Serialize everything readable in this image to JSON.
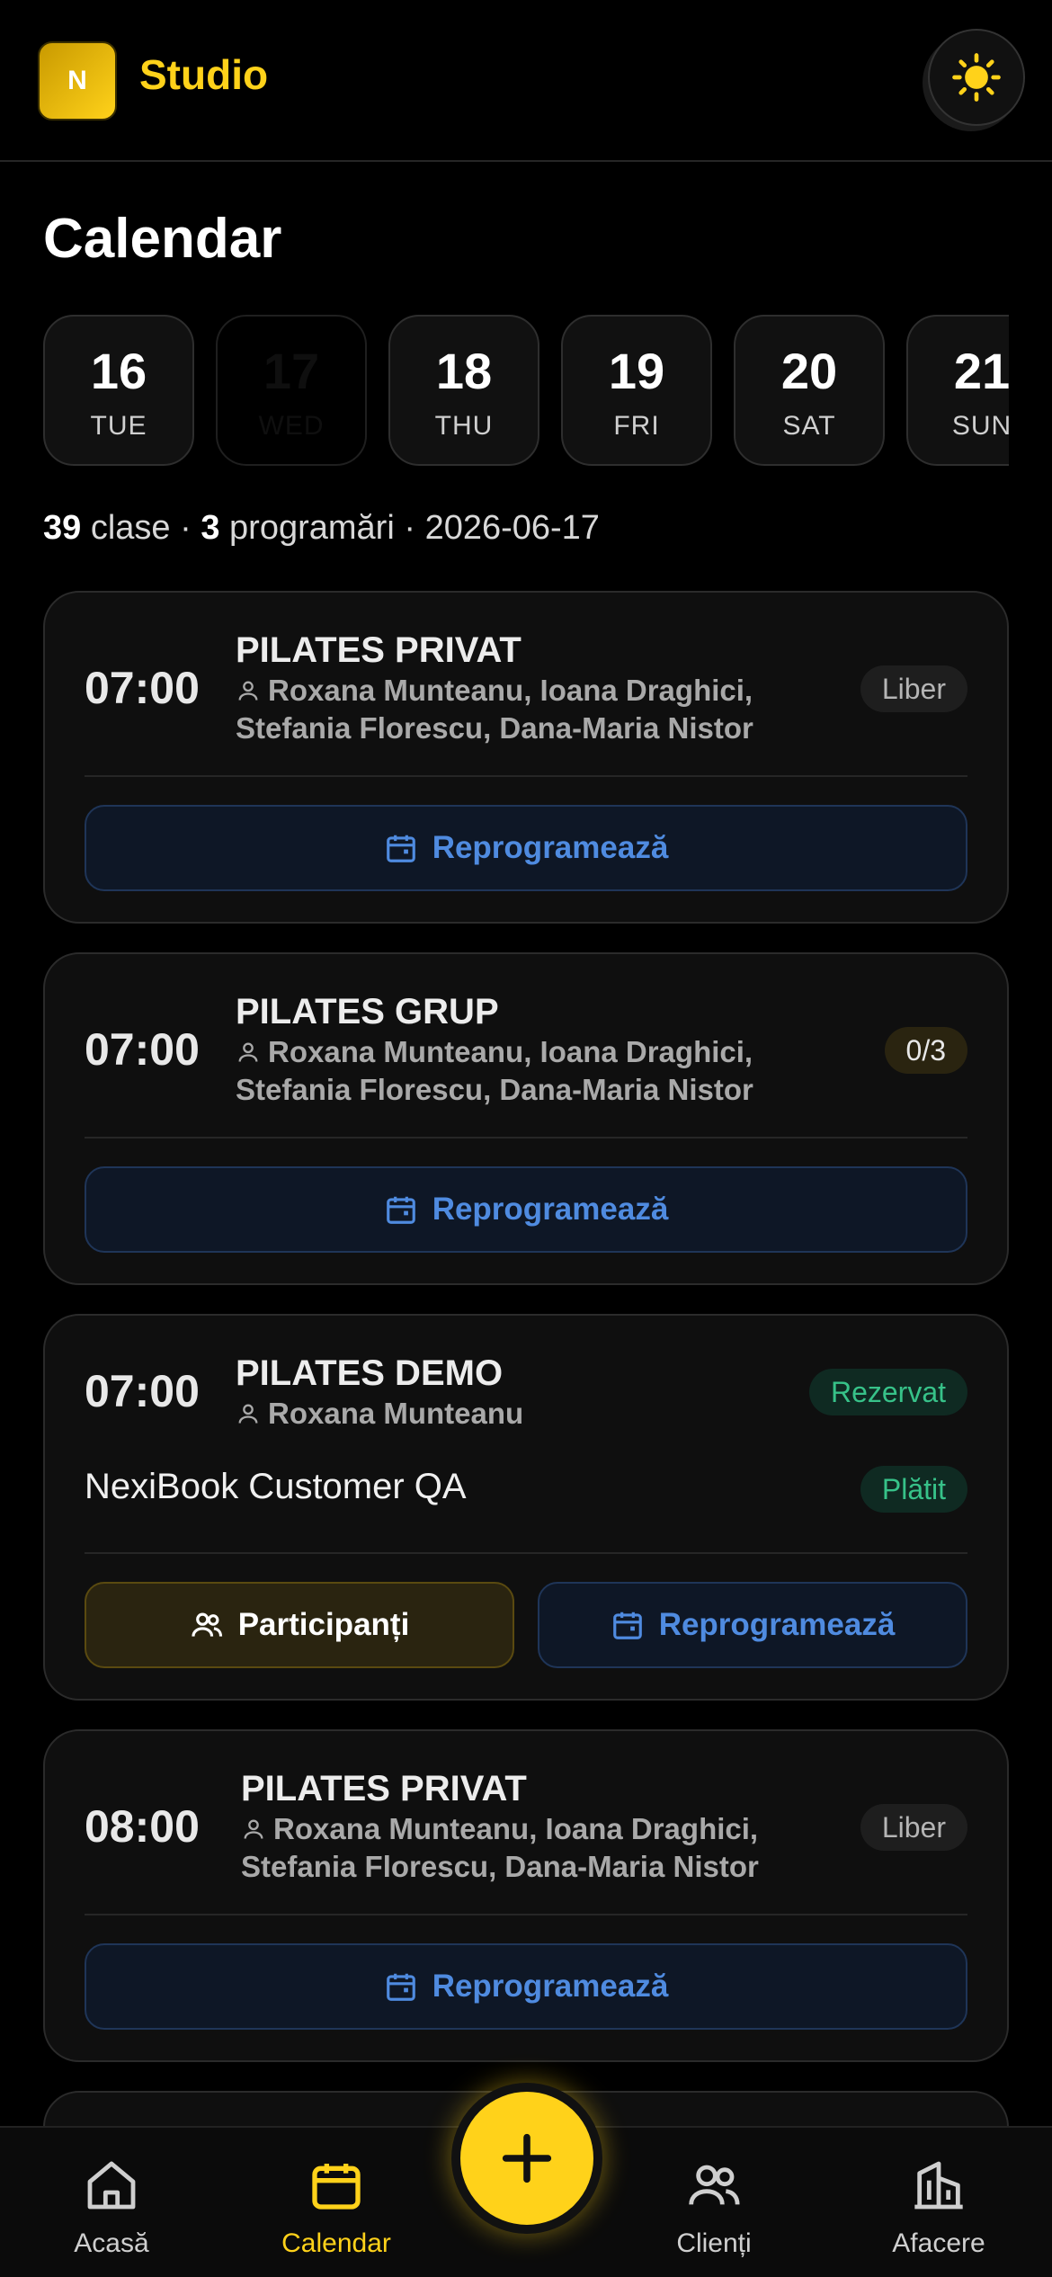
{
  "header": {
    "logo_letter": "N",
    "brand": "Studio",
    "theme_icon": "sun-icon"
  },
  "page_title": "Calendar",
  "days": [
    {
      "num": "16",
      "dow": "TUE"
    },
    {
      "num": "17",
      "dow": "WED",
      "selected": true
    },
    {
      "num": "18",
      "dow": "THU"
    },
    {
      "num": "19",
      "dow": "FRI"
    },
    {
      "num": "20",
      "dow": "SAT"
    },
    {
      "num": "21",
      "dow": "SUN"
    }
  ],
  "summary": {
    "classes_count": "39",
    "classes_label": "clase",
    "bookings_count": "3",
    "bookings_label": "programări",
    "date": "2026-06-17",
    "sep": "·"
  },
  "cards": [
    {
      "time": "07:00",
      "name": "PILATES PRIVAT",
      "people": "Roxana Munteanu, Ioana Draghici, Stefania Florescu, Dana-Maria Nistor",
      "badge": "Liber",
      "reschedule": "Reprogramează"
    },
    {
      "time": "07:00",
      "name": "PILATES GRUP",
      "people": "Roxana Munteanu, Ioana Draghici, Stefania Florescu, Dana-Maria Nistor",
      "badge": "0/3",
      "reschedule": "Reprogramează"
    },
    {
      "time": "07:00",
      "name": "PILATES DEMO",
      "people": "Roxana Munteanu",
      "badge": "Rezervat",
      "customer": "NexiBook Customer QA",
      "payment": "Plătit",
      "participants": "Participanți",
      "reschedule": "Reprogramează"
    },
    {
      "time": "08:00",
      "name": "PILATES PRIVAT",
      "people": "Roxana Munteanu, Ioana Draghici, Stefania Florescu, Dana-Maria Nistor",
      "badge": "Liber",
      "reschedule": "Reprogramează"
    }
  ],
  "nav": [
    {
      "label": "Acasă",
      "icon": "home-icon"
    },
    {
      "label": "Calendar",
      "icon": "calendar-icon",
      "active": true
    },
    {
      "label": "Clienți",
      "icon": "users-icon"
    },
    {
      "label": "Afacere",
      "icon": "building-icon"
    }
  ],
  "fab": {
    "icon": "plus-icon"
  },
  "colors": {
    "accent": "#ffd21a",
    "link": "#4f8be0",
    "success": "#37c289",
    "background": "#000000"
  }
}
